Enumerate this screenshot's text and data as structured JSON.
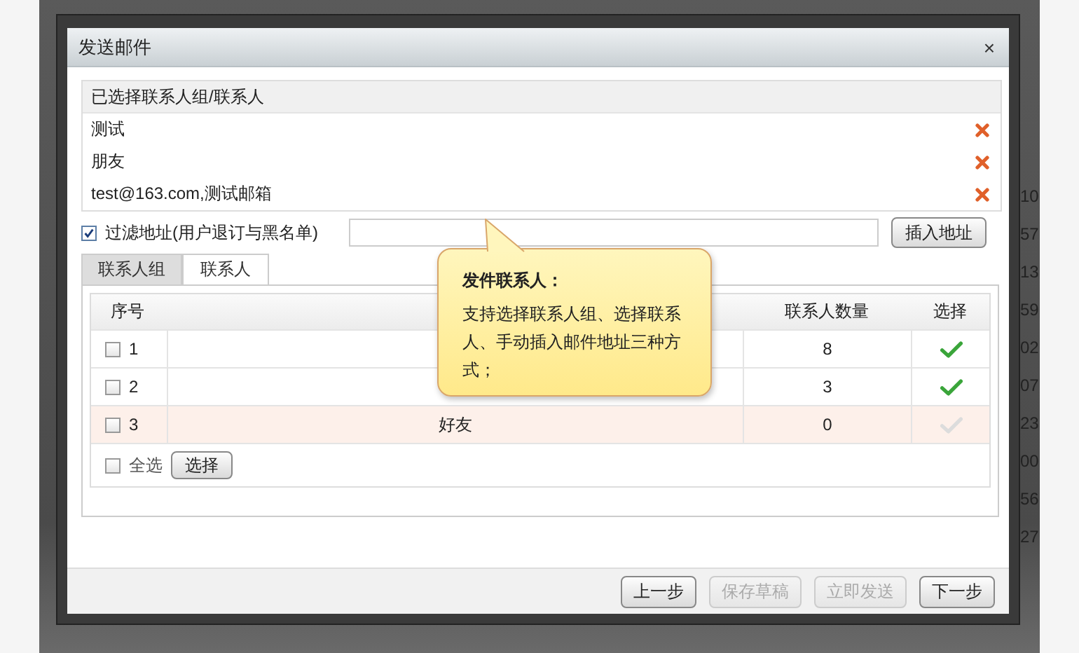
{
  "background": {
    "right_fragments": [
      "10",
      "57",
      "13",
      "59",
      "02",
      "07",
      "23",
      "00",
      "56",
      "27"
    ]
  },
  "dialog": {
    "title": "发送邮件",
    "close": "×"
  },
  "selected_panel": {
    "header": "已选择联系人组/联系人",
    "items": [
      {
        "label": "测试"
      },
      {
        "label": "朋友"
      },
      {
        "label": "test@163.com,测试邮箱"
      }
    ]
  },
  "filter": {
    "label": "过滤地址(用户退订与黑名单)",
    "checked": true,
    "insert_button": "插入地址"
  },
  "tabs": [
    {
      "label": "联系人组",
      "selected": false
    },
    {
      "label": "联系人",
      "selected": true
    }
  ],
  "table": {
    "columns": [
      "序号",
      "联系人数量",
      "选择"
    ],
    "rows": [
      {
        "index": "1",
        "count": "8",
        "checked": false,
        "chosen": true,
        "highlighted": false
      },
      {
        "index": "2",
        "count": "3",
        "checked": false,
        "chosen": true,
        "highlighted": false
      },
      {
        "index": "3",
        "name": "好友",
        "count": "0",
        "checked": false,
        "chosen": false,
        "highlighted": true
      }
    ],
    "select_all": {
      "label": "全选",
      "checked": false
    },
    "select_button": "选择"
  },
  "tooltip": {
    "title": "发件联系人：",
    "body": "支持选择联系人组、选择联系人、手动插入邮件地址三种方式；"
  },
  "footer_buttons": [
    {
      "label": "上一步",
      "disabled": false
    },
    {
      "label": "保存草稿",
      "disabled": true
    },
    {
      "label": "立即发送",
      "disabled": true
    },
    {
      "label": "下一步",
      "disabled": false
    }
  ]
}
